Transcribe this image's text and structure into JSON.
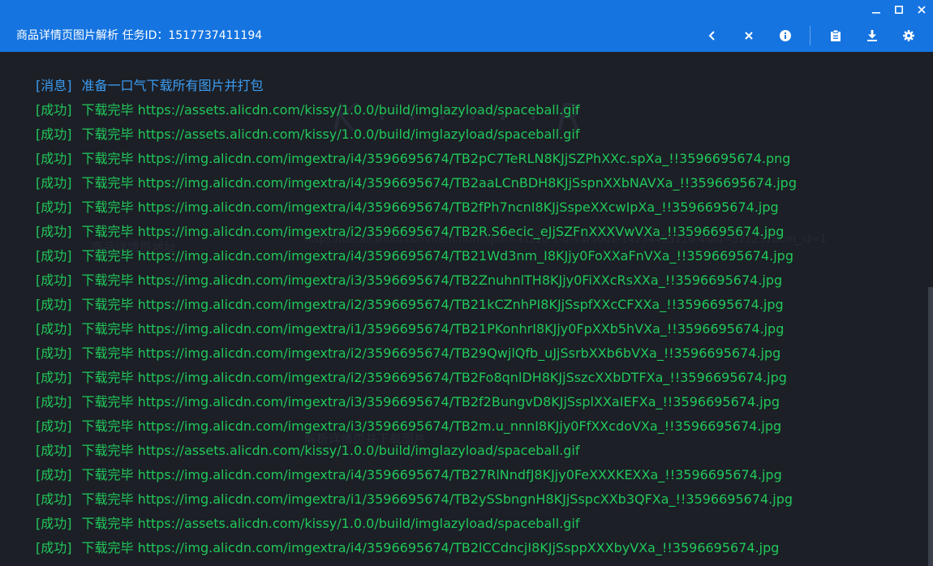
{
  "titlebar": {
    "app_title": "商品详情页图片解析 任务ID：1517737411194"
  },
  "colors": {
    "titlebar": "#1574e0",
    "background": "#1c1f26",
    "message": "#3c9cf2",
    "success": "#21c85a"
  },
  "window_controls": [
    "minimize-icon",
    "maximize-icon",
    "close-icon"
  ],
  "toolbar_icons": [
    "chevron-left-icon",
    "close-icon",
    "info-icon",
    "clipboard-icon",
    "download-icon",
    "gear-icon"
  ],
  "log": [
    {
      "kind": "msg",
      "tag": "[消息]",
      "text": "准备一口气下载所有图片并打包"
    },
    {
      "kind": "ok",
      "tag": "[成功]",
      "text": "下载完毕 https://assets.alicdn.com/kissy/1.0.0/build/imglazyload/spaceball.gif"
    },
    {
      "kind": "ok",
      "tag": "[成功]",
      "text": "下载完毕 https://assets.alicdn.com/kissy/1.0.0/build/imglazyload/spaceball.gif"
    },
    {
      "kind": "ok",
      "tag": "[成功]",
      "text": "下载完毕 https://img.alicdn.com/imgextra/i4/3596695674/TB2pC7TeRLN8KJjSZPhXXc.spXa_!!3596695674.png"
    },
    {
      "kind": "ok",
      "tag": "[成功]",
      "text": "下载完毕 https://img.alicdn.com/imgextra/i4/3596695674/TB2aaLCnBDH8KJjSspnXXbNAVXa_!!3596695674.jpg"
    },
    {
      "kind": "ok",
      "tag": "[成功]",
      "text": "下载完毕 https://img.alicdn.com/imgextra/i4/3596695674/TB2fPh7ncnI8KJjSspeXXcwIpXa_!!3596695674.jpg"
    },
    {
      "kind": "ok",
      "tag": "[成功]",
      "text": "下载完毕 https://img.alicdn.com/imgextra/i2/3596695674/TB2R.S6ecic_eJjSZFnXXXVwVXa_!!3596695674.jpg"
    },
    {
      "kind": "ok",
      "tag": "[成功]",
      "text": "下载完毕 https://img.alicdn.com/imgextra/i4/3596695674/TB21Wd3nm_I8KJjy0FoXXaFnVXa_!!3596695674.jpg"
    },
    {
      "kind": "ok",
      "tag": "[成功]",
      "text": "下载完毕 https://img.alicdn.com/imgextra/i3/3596695674/TB2ZnuhnlTH8KJjy0FiXXcRsXXa_!!3596695674.jpg"
    },
    {
      "kind": "ok",
      "tag": "[成功]",
      "text": "下载完毕 https://img.alicdn.com/imgextra/i2/3596695674/TB21kCZnhPI8KJjSspfXXcCFXXa_!!3596695674.jpg"
    },
    {
      "kind": "ok",
      "tag": "[成功]",
      "text": "下载完毕 https://img.alicdn.com/imgextra/i1/3596695674/TB21PKonhrI8KJjy0FpXXb5hVXa_!!3596695674.jpg"
    },
    {
      "kind": "ok",
      "tag": "[成功]",
      "text": "下载完毕 https://img.alicdn.com/imgextra/i2/3596695674/TB29QwjlQfb_uJjSsrbXXb6bVXa_!!3596695674.jpg"
    },
    {
      "kind": "ok",
      "tag": "[成功]",
      "text": "下载完毕 https://img.alicdn.com/imgextra/i2/3596695674/TB2Fo8qnlDH8KJjSszcXXbDTFXa_!!3596695674.jpg"
    },
    {
      "kind": "ok",
      "tag": "[成功]",
      "text": "下载完毕 https://img.alicdn.com/imgextra/i3/3596695674/TB2f2BungvD8KJjSsplXXaIEFXa_!!3596695674.jpg"
    },
    {
      "kind": "ok",
      "tag": "[成功]",
      "text": "下载完毕 https://img.alicdn.com/imgextra/i3/3596695674/TB2m.u_nnnI8KJjy0FfXXcdoVXa_!!3596695674.jpg"
    },
    {
      "kind": "ok",
      "tag": "[成功]",
      "text": "下载完毕 https://assets.alicdn.com/kissy/1.0.0/build/imglazyload/spaceball.gif"
    },
    {
      "kind": "ok",
      "tag": "[成功]",
      "text": "下载完毕 https://img.alicdn.com/imgextra/i4/3596695674/TB27RlNndfJ8KJjy0FeXXXKEXXa_!!3596695674.jpg"
    },
    {
      "kind": "ok",
      "tag": "[成功]",
      "text": "下载完毕 https://img.alicdn.com/imgextra/i1/3596695674/TB2ySSbngnH8KJjSspcXXb3QFXa_!!3596695674.jpg"
    },
    {
      "kind": "ok",
      "tag": "[成功]",
      "text": "下载完毕 https://assets.alicdn.com/kissy/1.0.0/build/imglazyload/spaceball.gif"
    },
    {
      "kind": "ok",
      "tag": "[成功]",
      "text": "下载完毕 https://img.alicdn.com/imgextra/i4/3596695674/TB2lCCdncjI8KJjSsppXXXbyVXa_!!3596695674.jpg"
    }
  ]
}
